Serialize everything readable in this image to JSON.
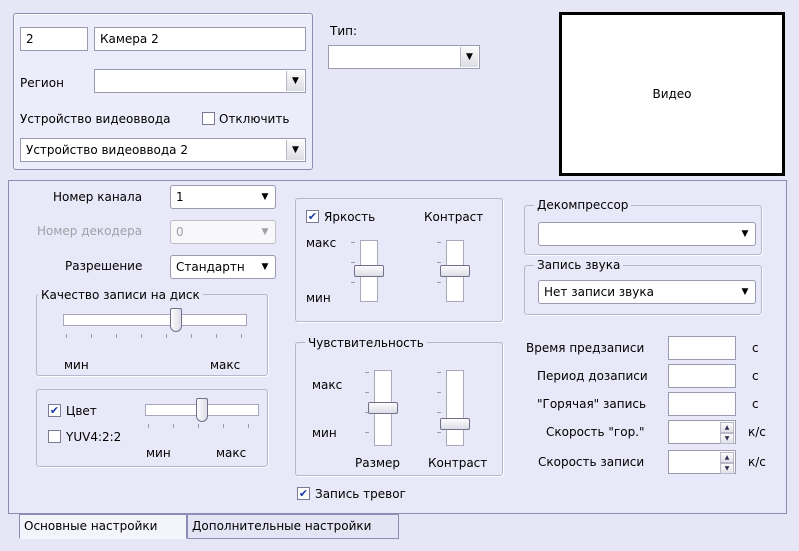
{
  "camera": {
    "id": "2",
    "name": "Камера 2",
    "region_label": "Регион",
    "region_value": "",
    "input_device_label": "Устройство видеоввода",
    "disable_label": "Отключить",
    "disable_checked": false,
    "input_device_value": "Устройство видеоввода 2"
  },
  "type": {
    "label": "Тип:",
    "value": ""
  },
  "video": {
    "label": "Видео"
  },
  "channel": {
    "channel_label": "Номер канала",
    "channel_value": "1",
    "decoder_label": "Номер декодера",
    "decoder_value": "0",
    "resolution_label": "Разрешение",
    "resolution_value": "Стандартн"
  },
  "quality": {
    "title": "Качество записи на диск",
    "min_label": "мин",
    "max_label": "макс",
    "level": 0.62
  },
  "color": {
    "color_label": "Цвет",
    "color_checked": true,
    "yuv_label": "YUV4:2:2",
    "yuv_checked": false,
    "min_label": "мин",
    "max_label": "макс",
    "level": 0.5
  },
  "brightness": {
    "brightness_label": "Яркость",
    "brightness_checked": true,
    "contrast_label": "Контраст",
    "max_label": "макс",
    "min_label": "мин",
    "brightness_level": 0.5,
    "contrast_level": 0.5
  },
  "sensitivity": {
    "title": "Чувствительность",
    "max_label": "макс",
    "min_label": "мин",
    "size_label": "Размер",
    "contrast_label": "Контраст",
    "size_level": 0.5,
    "contrast_level": 0.25
  },
  "alarm_record": {
    "label": "Запись тревог",
    "checked": true
  },
  "decompressor": {
    "title": "Декомпрессор",
    "value": ""
  },
  "sound": {
    "title": "Запись звука",
    "value": "Нет записи звука"
  },
  "timing": {
    "prerecord_label": "Время предзаписи",
    "prerecord_value": "",
    "prerecord_unit": "с",
    "postrecord_label": "Период дозаписи",
    "postrecord_value": "",
    "postrecord_unit": "с",
    "hot_label": "\"Горячая\" запись",
    "hot_value": "",
    "hot_unit": "с",
    "hot_speed_label": "Скорость \"гор.\"",
    "hot_speed_value": "",
    "hot_speed_unit": "к/с",
    "rec_speed_label": "Скорость записи",
    "rec_speed_value": "",
    "rec_speed_unit": "к/с"
  },
  "tabs": [
    {
      "label": "Основные настройки",
      "active": true
    },
    {
      "label": "Дополнительные настройки",
      "active": false
    }
  ],
  "icons": {
    "dropdown": "dropdown-arrow-icon",
    "check": "checkmark-icon",
    "spin_up": "spin-up-icon",
    "spin_down": "spin-down-icon"
  }
}
